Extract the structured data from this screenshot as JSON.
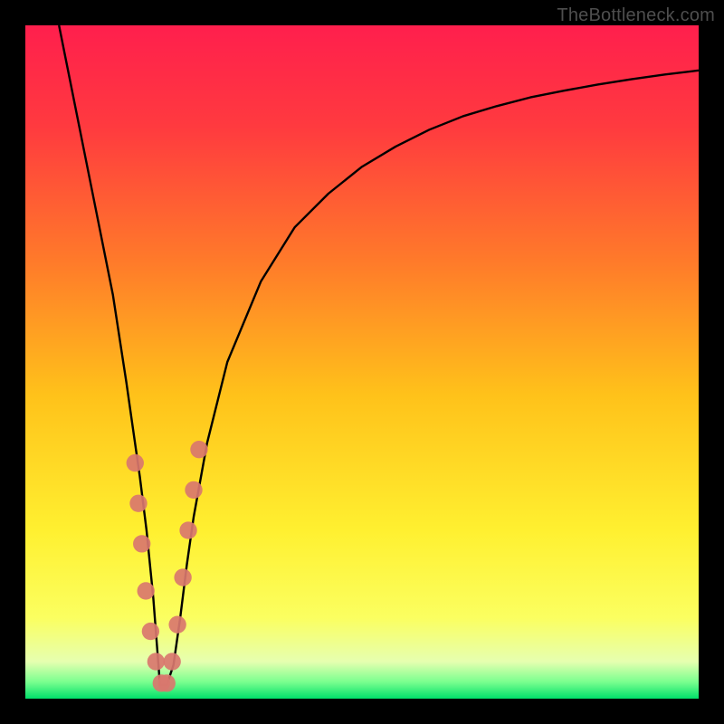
{
  "watermark": "TheBottleneck.com",
  "chart_data": {
    "type": "line",
    "title": "",
    "xlabel": "",
    "ylabel": "",
    "xlim": [
      0,
      100
    ],
    "ylim": [
      0,
      100
    ],
    "gradient_stops": [
      {
        "offset": 0.0,
        "color": "#ff1f4d"
      },
      {
        "offset": 0.15,
        "color": "#ff3a3f"
      },
      {
        "offset": 0.35,
        "color": "#ff7a2a"
      },
      {
        "offset": 0.55,
        "color": "#ffc21a"
      },
      {
        "offset": 0.75,
        "color": "#fff030"
      },
      {
        "offset": 0.88,
        "color": "#fbff60"
      },
      {
        "offset": 0.945,
        "color": "#e6ffb0"
      },
      {
        "offset": 0.975,
        "color": "#7bff8f"
      },
      {
        "offset": 1.0,
        "color": "#00e06a"
      }
    ],
    "series": [
      {
        "name": "bottleneck-curve",
        "minimum_x": 20,
        "x": [
          5,
          7,
          9,
          11,
          13,
          15,
          16,
          17,
          18,
          19,
          20,
          21,
          22,
          23,
          24,
          25,
          27,
          30,
          35,
          40,
          45,
          50,
          55,
          60,
          65,
          70,
          75,
          80,
          85,
          90,
          95,
          100
        ],
        "y": [
          100,
          90,
          80,
          70,
          60,
          47,
          40,
          33,
          25,
          15,
          2,
          2,
          5,
          12,
          20,
          27,
          38,
          50,
          62,
          70,
          75,
          79,
          82,
          84.5,
          86.5,
          88,
          89.3,
          90.3,
          91.2,
          92,
          92.7,
          93.3
        ]
      }
    ],
    "markers": {
      "name": "highlight-dots",
      "color": "#d9776e",
      "radius_pct": 1.3,
      "points": [
        {
          "x": 16.3,
          "y": 35
        },
        {
          "x": 16.8,
          "y": 29
        },
        {
          "x": 17.3,
          "y": 23
        },
        {
          "x": 17.9,
          "y": 16
        },
        {
          "x": 18.6,
          "y": 10
        },
        {
          "x": 19.4,
          "y": 5.5
        },
        {
          "x": 20.2,
          "y": 2.3
        },
        {
          "x": 21.0,
          "y": 2.3
        },
        {
          "x": 21.8,
          "y": 5.5
        },
        {
          "x": 22.6,
          "y": 11
        },
        {
          "x": 23.4,
          "y": 18
        },
        {
          "x": 24.2,
          "y": 25
        },
        {
          "x": 25.0,
          "y": 31
        },
        {
          "x": 25.8,
          "y": 37
        }
      ]
    }
  }
}
